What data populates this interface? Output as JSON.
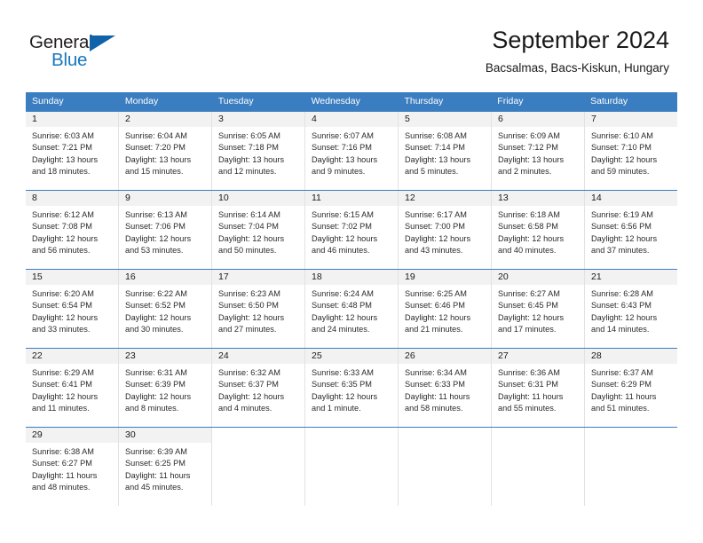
{
  "brand": {
    "word_one": "General",
    "word_two": "Blue",
    "flag_icon": "triangle-flag-icon"
  },
  "header": {
    "month_title": "September 2024",
    "location": "Bacsalmas, Bacs-Kiskun, Hungary"
  },
  "colors": {
    "header_blue": "#3a7dc0",
    "brand_blue": "#1878be",
    "daynum_band": "#f2f2f2",
    "cell_border": "#e2e2e2"
  },
  "weekdays": [
    "Sunday",
    "Monday",
    "Tuesday",
    "Wednesday",
    "Thursday",
    "Friday",
    "Saturday"
  ],
  "weeks": [
    [
      {
        "day": "1",
        "sunrise": "Sunrise: 6:03 AM",
        "sunset": "Sunset: 7:21 PM",
        "daylight_1": "Daylight: 13 hours",
        "daylight_2": "and 18 minutes."
      },
      {
        "day": "2",
        "sunrise": "Sunrise: 6:04 AM",
        "sunset": "Sunset: 7:20 PM",
        "daylight_1": "Daylight: 13 hours",
        "daylight_2": "and 15 minutes."
      },
      {
        "day": "3",
        "sunrise": "Sunrise: 6:05 AM",
        "sunset": "Sunset: 7:18 PM",
        "daylight_1": "Daylight: 13 hours",
        "daylight_2": "and 12 minutes."
      },
      {
        "day": "4",
        "sunrise": "Sunrise: 6:07 AM",
        "sunset": "Sunset: 7:16 PM",
        "daylight_1": "Daylight: 13 hours",
        "daylight_2": "and 9 minutes."
      },
      {
        "day": "5",
        "sunrise": "Sunrise: 6:08 AM",
        "sunset": "Sunset: 7:14 PM",
        "daylight_1": "Daylight: 13 hours",
        "daylight_2": "and 5 minutes."
      },
      {
        "day": "6",
        "sunrise": "Sunrise: 6:09 AM",
        "sunset": "Sunset: 7:12 PM",
        "daylight_1": "Daylight: 13 hours",
        "daylight_2": "and 2 minutes."
      },
      {
        "day": "7",
        "sunrise": "Sunrise: 6:10 AM",
        "sunset": "Sunset: 7:10 PM",
        "daylight_1": "Daylight: 12 hours",
        "daylight_2": "and 59 minutes."
      }
    ],
    [
      {
        "day": "8",
        "sunrise": "Sunrise: 6:12 AM",
        "sunset": "Sunset: 7:08 PM",
        "daylight_1": "Daylight: 12 hours",
        "daylight_2": "and 56 minutes."
      },
      {
        "day": "9",
        "sunrise": "Sunrise: 6:13 AM",
        "sunset": "Sunset: 7:06 PM",
        "daylight_1": "Daylight: 12 hours",
        "daylight_2": "and 53 minutes."
      },
      {
        "day": "10",
        "sunrise": "Sunrise: 6:14 AM",
        "sunset": "Sunset: 7:04 PM",
        "daylight_1": "Daylight: 12 hours",
        "daylight_2": "and 50 minutes."
      },
      {
        "day": "11",
        "sunrise": "Sunrise: 6:15 AM",
        "sunset": "Sunset: 7:02 PM",
        "daylight_1": "Daylight: 12 hours",
        "daylight_2": "and 46 minutes."
      },
      {
        "day": "12",
        "sunrise": "Sunrise: 6:17 AM",
        "sunset": "Sunset: 7:00 PM",
        "daylight_1": "Daylight: 12 hours",
        "daylight_2": "and 43 minutes."
      },
      {
        "day": "13",
        "sunrise": "Sunrise: 6:18 AM",
        "sunset": "Sunset: 6:58 PM",
        "daylight_1": "Daylight: 12 hours",
        "daylight_2": "and 40 minutes."
      },
      {
        "day": "14",
        "sunrise": "Sunrise: 6:19 AM",
        "sunset": "Sunset: 6:56 PM",
        "daylight_1": "Daylight: 12 hours",
        "daylight_2": "and 37 minutes."
      }
    ],
    [
      {
        "day": "15",
        "sunrise": "Sunrise: 6:20 AM",
        "sunset": "Sunset: 6:54 PM",
        "daylight_1": "Daylight: 12 hours",
        "daylight_2": "and 33 minutes."
      },
      {
        "day": "16",
        "sunrise": "Sunrise: 6:22 AM",
        "sunset": "Sunset: 6:52 PM",
        "daylight_1": "Daylight: 12 hours",
        "daylight_2": "and 30 minutes."
      },
      {
        "day": "17",
        "sunrise": "Sunrise: 6:23 AM",
        "sunset": "Sunset: 6:50 PM",
        "daylight_1": "Daylight: 12 hours",
        "daylight_2": "and 27 minutes."
      },
      {
        "day": "18",
        "sunrise": "Sunrise: 6:24 AM",
        "sunset": "Sunset: 6:48 PM",
        "daylight_1": "Daylight: 12 hours",
        "daylight_2": "and 24 minutes."
      },
      {
        "day": "19",
        "sunrise": "Sunrise: 6:25 AM",
        "sunset": "Sunset: 6:46 PM",
        "daylight_1": "Daylight: 12 hours",
        "daylight_2": "and 21 minutes."
      },
      {
        "day": "20",
        "sunrise": "Sunrise: 6:27 AM",
        "sunset": "Sunset: 6:45 PM",
        "daylight_1": "Daylight: 12 hours",
        "daylight_2": "and 17 minutes."
      },
      {
        "day": "21",
        "sunrise": "Sunrise: 6:28 AM",
        "sunset": "Sunset: 6:43 PM",
        "daylight_1": "Daylight: 12 hours",
        "daylight_2": "and 14 minutes."
      }
    ],
    [
      {
        "day": "22",
        "sunrise": "Sunrise: 6:29 AM",
        "sunset": "Sunset: 6:41 PM",
        "daylight_1": "Daylight: 12 hours",
        "daylight_2": "and 11 minutes."
      },
      {
        "day": "23",
        "sunrise": "Sunrise: 6:31 AM",
        "sunset": "Sunset: 6:39 PM",
        "daylight_1": "Daylight: 12 hours",
        "daylight_2": "and 8 minutes."
      },
      {
        "day": "24",
        "sunrise": "Sunrise: 6:32 AM",
        "sunset": "Sunset: 6:37 PM",
        "daylight_1": "Daylight: 12 hours",
        "daylight_2": "and 4 minutes."
      },
      {
        "day": "25",
        "sunrise": "Sunrise: 6:33 AM",
        "sunset": "Sunset: 6:35 PM",
        "daylight_1": "Daylight: 12 hours",
        "daylight_2": "and 1 minute."
      },
      {
        "day": "26",
        "sunrise": "Sunrise: 6:34 AM",
        "sunset": "Sunset: 6:33 PM",
        "daylight_1": "Daylight: 11 hours",
        "daylight_2": "and 58 minutes."
      },
      {
        "day": "27",
        "sunrise": "Sunrise: 6:36 AM",
        "sunset": "Sunset: 6:31 PM",
        "daylight_1": "Daylight: 11 hours",
        "daylight_2": "and 55 minutes."
      },
      {
        "day": "28",
        "sunrise": "Sunrise: 6:37 AM",
        "sunset": "Sunset: 6:29 PM",
        "daylight_1": "Daylight: 11 hours",
        "daylight_2": "and 51 minutes."
      }
    ],
    [
      {
        "day": "29",
        "sunrise": "Sunrise: 6:38 AM",
        "sunset": "Sunset: 6:27 PM",
        "daylight_1": "Daylight: 11 hours",
        "daylight_2": "and 48 minutes."
      },
      {
        "day": "30",
        "sunrise": "Sunrise: 6:39 AM",
        "sunset": "Sunset: 6:25 PM",
        "daylight_1": "Daylight: 11 hours",
        "daylight_2": "and 45 minutes."
      },
      {
        "day": "",
        "sunrise": "",
        "sunset": "",
        "daylight_1": "",
        "daylight_2": ""
      },
      {
        "day": "",
        "sunrise": "",
        "sunset": "",
        "daylight_1": "",
        "daylight_2": ""
      },
      {
        "day": "",
        "sunrise": "",
        "sunset": "",
        "daylight_1": "",
        "daylight_2": ""
      },
      {
        "day": "",
        "sunrise": "",
        "sunset": "",
        "daylight_1": "",
        "daylight_2": ""
      },
      {
        "day": "",
        "sunrise": "",
        "sunset": "",
        "daylight_1": "",
        "daylight_2": ""
      }
    ]
  ]
}
